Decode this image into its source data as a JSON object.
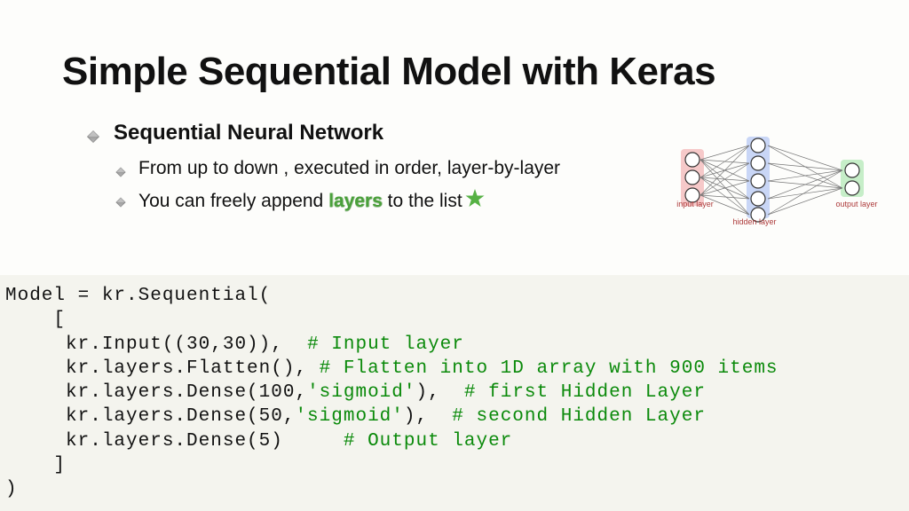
{
  "title": "Simple Sequential Model with Keras",
  "bullets": {
    "l1": "Sequential Neural Network",
    "l2a": "From up to down , executed in order, layer-by-layer",
    "l2b_pre": "You can freely append ",
    "l2b_hl": "layers",
    "l2b_post": " to the list"
  },
  "nn_labels": {
    "input": "input layer",
    "hidden": "hidden layer",
    "output": "output layer"
  },
  "code": {
    "l1": "Model = kr.Sequential(",
    "l2": "    [",
    "l3_code": "     kr.Input((30,30)),  ",
    "l3_cmt": "# Input layer",
    "l4_code": "     kr.layers.Flatten(), ",
    "l4_cmt": "# Flatten into 1D array with 900 items",
    "l5_code_a": "     kr.layers.Dense(100,",
    "l5_str": "'sigmoid'",
    "l5_code_b": "),  ",
    "l5_cmt": "# first Hidden Layer",
    "l6_code_a": "     kr.layers.Dense(50,",
    "l6_str": "'sigmoid'",
    "l6_code_b": "),  ",
    "l6_cmt": "# second Hidden Layer",
    "l7_code": "     kr.layers.Dense(5)     ",
    "l7_cmt": "# Output layer",
    "l8": "    ]",
    "l9": ")"
  }
}
